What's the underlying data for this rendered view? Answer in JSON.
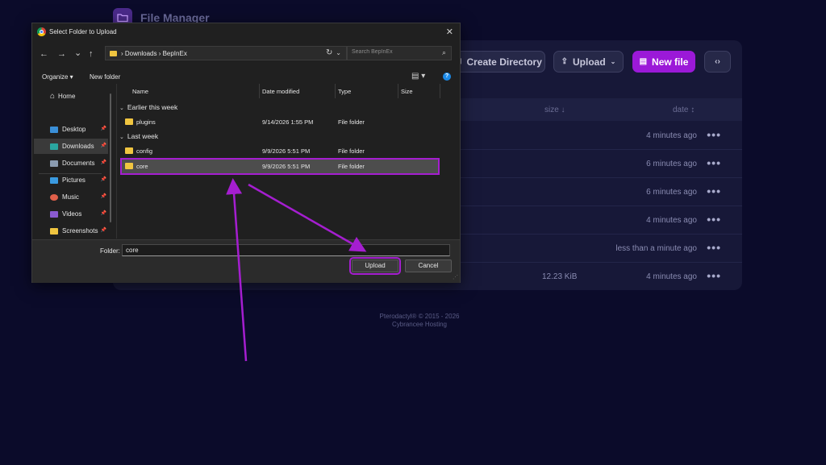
{
  "app": {
    "title": "File Manager",
    "toolbar": {
      "create_directory": "Create Directory",
      "upload": "Upload",
      "new_file": "New file"
    },
    "table": {
      "headers": {
        "size": "size ↓",
        "date": "date ↕"
      },
      "rows": [
        {
          "size": "",
          "date": "4 minutes ago"
        },
        {
          "size": "",
          "date": "6 minutes ago"
        },
        {
          "size": "",
          "date": "6 minutes ago"
        },
        {
          "size": "",
          "date": "4 minutes ago"
        },
        {
          "size": "",
          "date": "less than a minute ago"
        },
        {
          "size": "12.23 KiB",
          "date": "4 minutes ago"
        }
      ],
      "row_menu": "•••"
    },
    "footer": {
      "line1": "Pterodactyl® © 2015 - 2026",
      "line2": "Cybrancee Hosting"
    },
    "colors": {
      "background": "#0b0b2a",
      "panel": "#171838",
      "accent": "#9b19d8"
    }
  },
  "dialog": {
    "title": "Select Folder to Upload",
    "close": "✕",
    "nav": {
      "back": "←",
      "forward": "→",
      "recent": "⌄",
      "up": "↑"
    },
    "address": {
      "path": "›  Downloads  ›  BepInEx",
      "dropdown": "⌄",
      "refresh": "↻"
    },
    "search": {
      "placeholder": "Search BepInEx",
      "icon": "search-icon"
    },
    "commands": {
      "organize": "Organize ▾",
      "new_folder": "New folder",
      "view": "▤ ▾",
      "help": "?"
    },
    "sidebar": {
      "home": "Home",
      "items": [
        {
          "label": "Desktop",
          "icon": "desktop-icon",
          "color": "#3a8fd8"
        },
        {
          "label": "Downloads",
          "icon": "download-icon",
          "color": "#2aa6a0"
        },
        {
          "label": "Documents",
          "icon": "document-icon",
          "color": "#8a9bb0"
        },
        {
          "label": "Pictures",
          "icon": "picture-icon",
          "color": "#3a9ae0"
        },
        {
          "label": "Music",
          "icon": "music-icon",
          "color": "#e0604a"
        },
        {
          "label": "Videos",
          "icon": "video-icon",
          "color": "#8a5ad0"
        },
        {
          "label": "Screenshots",
          "icon": "folder-icon",
          "color": "#f0c540"
        }
      ],
      "pin": "📌"
    },
    "columns": {
      "name": "Name",
      "date": "Date modified",
      "type": "Type",
      "size": "Size"
    },
    "groups": [
      {
        "label": "Earlier this week",
        "files": [
          {
            "name": "plugins",
            "date": "9/14/2026 1:55 PM",
            "type": "File folder"
          }
        ]
      },
      {
        "label": "Last week",
        "files": [
          {
            "name": "config",
            "date": "9/9/2026 5:51 PM",
            "type": "File folder"
          },
          {
            "name": "core",
            "date": "9/9/2026 5:51 PM",
            "type": "File folder"
          }
        ]
      }
    ],
    "folder_label": "Folder:",
    "folder_value": "core",
    "upload_button": "Upload",
    "cancel_button": "Cancel",
    "highlight_color": "#a51ed0"
  }
}
